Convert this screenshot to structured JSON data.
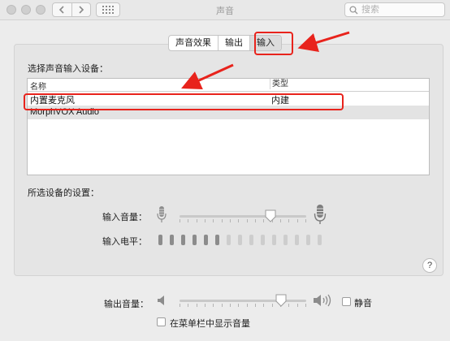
{
  "window": {
    "title": "声音"
  },
  "search": {
    "placeholder": "搜索"
  },
  "tabs": [
    {
      "label": "声音效果",
      "active": false
    },
    {
      "label": "输出",
      "active": false
    },
    {
      "label": "输入",
      "active": true
    }
  ],
  "input_section": {
    "label": "选择声音输入设备：",
    "columns": [
      "名称",
      "类型"
    ],
    "rows": [
      {
        "name": "内置麦克风",
        "type": "内建",
        "selected": true
      },
      {
        "name": "MorphVOX Audio",
        "type": "",
        "selected": false
      }
    ]
  },
  "device_settings": {
    "label": "所选设备的设置：",
    "input_volume_label": "输入音量：",
    "input_volume_level": 0.72,
    "input_level_label": "输入电平：",
    "input_level_segments_total": 15,
    "input_level_segments_lit": 6
  },
  "help_label": "?",
  "output": {
    "volume_label": "输出音量：",
    "volume_level": 0.8,
    "mute_label": "静音",
    "mute_checked": false,
    "show_in_menubar_label": "在菜单栏中显示音量",
    "show_in_menubar_checked": false
  },
  "colors": {
    "annotation_red": "#e8231c",
    "window_bg": "#ececec",
    "panel_bg": "#e5e5e5"
  },
  "icons": [
    "back-icon",
    "forward-icon",
    "grid-icon",
    "search-icon",
    "microphone-icon",
    "speaker-icon",
    "speaker-loud-icon",
    "help-icon"
  ]
}
